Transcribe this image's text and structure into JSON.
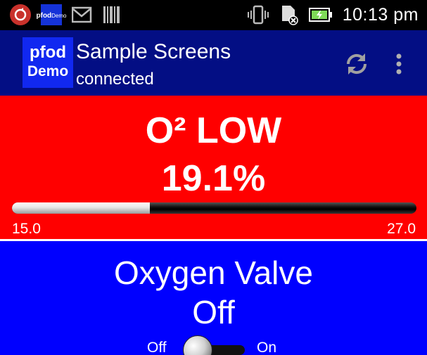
{
  "status_bar": {
    "time": "10:13 pm",
    "app_logo_line1": "pfod",
    "app_logo_line2": "Demo",
    "icons": [
      "sync-icon",
      "pfod-app-icon",
      "gmail-icon",
      "barcode-icon",
      "vibrate-icon",
      "sdcard-icon",
      "battery-charging-icon"
    ]
  },
  "action_bar": {
    "logo_line1": "pfod",
    "logo_line2": "Demo",
    "title": "Sample Screens",
    "subtitle": "connected",
    "colors": {
      "background": "#030e84",
      "logo": "#1128f0"
    }
  },
  "oxygen_panel": {
    "title": "O² LOW",
    "value": "19.1%",
    "min_label": "15.0",
    "max_label": "27.0",
    "min": 15.0,
    "max": 27.0,
    "current": 19.1,
    "background": "#ff0000"
  },
  "valve_panel": {
    "title": "Oxygen Valve",
    "state": "Off",
    "off_label": "Off",
    "on_label": "On",
    "is_on": false,
    "background": "#0000ff"
  }
}
